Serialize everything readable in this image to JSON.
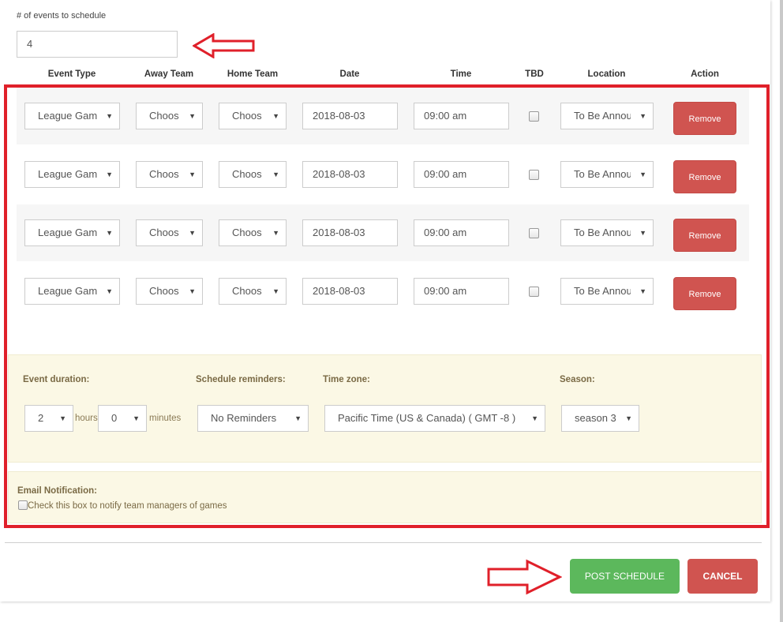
{
  "count_field": {
    "label": "# of events to schedule",
    "value": "4"
  },
  "columns": [
    "Event Type",
    "Away Team",
    "Home Team",
    "Date",
    "Time",
    "TBD",
    "Location",
    "Action"
  ],
  "rows": [
    {
      "event_type": "League Gam ",
      "away_team": "Choos",
      "home_team": "Choos ",
      "date": "2018-08-03",
      "time": "09:00 am",
      "tbd": false,
      "location": "To Be Annou",
      "action": "Remove"
    },
    {
      "event_type": "League Gam ",
      "away_team": "Choos",
      "home_team": "Choos ",
      "date": "2018-08-03",
      "time": "09:00 am",
      "tbd": false,
      "location": "To Be Annou",
      "action": "Remove"
    },
    {
      "event_type": "League Gam ",
      "away_team": "Choos",
      "home_team": "Choos ",
      "date": "2018-08-03",
      "time": "09:00 am",
      "tbd": false,
      "location": "To Be Annou",
      "action": "Remove"
    },
    {
      "event_type": "League Gam ",
      "away_team": "Choos",
      "home_team": "Choos ",
      "date": "2018-08-03",
      "time": "09:00 am",
      "tbd": false,
      "location": "To Be Annou",
      "action": "Remove"
    }
  ],
  "options": {
    "duration_label": "Event duration:",
    "duration_hours": "2",
    "hours_unit": "hours",
    "duration_minutes": "0",
    "minutes_unit": "minutes",
    "reminders_label": "Schedule reminders:",
    "reminders_value": "No Reminders",
    "timezone_label": "Time zone:",
    "timezone_value": "Pacific Time (US & Canada) ( GMT -8 )",
    "season_label": "Season:",
    "season_value": "season 3"
  },
  "email": {
    "label": "Email Notification:",
    "checkbox_text": "Check this box to notify team managers of games",
    "checked": false
  },
  "footer": {
    "post_label": "POST SCHEDULE",
    "cancel_label": "CANCEL"
  },
  "colors": {
    "annotation_red": "#e0202a",
    "post_green": "#5cb85c",
    "danger_red": "#d05450",
    "options_bg": "#fbf8e5"
  }
}
